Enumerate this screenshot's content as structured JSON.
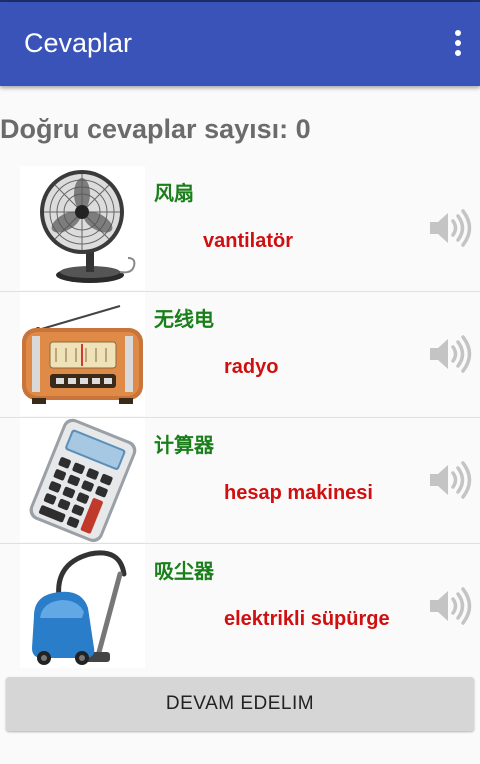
{
  "app": {
    "title": "Cevaplar"
  },
  "score": {
    "text": "Doğru cevaplar sayısı: 0"
  },
  "items": [
    {
      "native": "风扇",
      "translation": "vantilatör",
      "image": "fan-icon"
    },
    {
      "native": "无线电",
      "translation": "radyo",
      "image": "radio-icon"
    },
    {
      "native": "计算器",
      "translation": "hesap makinesi",
      "image": "calculator-icon"
    },
    {
      "native": "吸尘器",
      "translation": "elektrikli süpürge",
      "image": "vacuum-cleaner-icon"
    }
  ],
  "actions": {
    "continue_label": "DEVAM EDELIM"
  },
  "colors": {
    "appbar": "#3a53b8",
    "native_text": "#1a7f1a",
    "translation_text": "#d01010",
    "score_text": "#6b6b6b",
    "button_bg": "#d6d6d6"
  },
  "icons": {
    "menu": "more-vert-icon",
    "audio": "speaker-icon"
  }
}
